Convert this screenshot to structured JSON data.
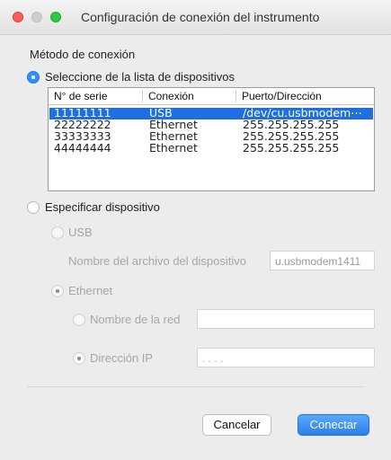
{
  "window": {
    "title": "Configuración de conexión del instrumento",
    "close_color": "#fd5f57",
    "minimize_color": "#cfcfcf",
    "zoom_color": "#2ac940"
  },
  "connection_method": {
    "label": "Método de conexión",
    "list_option": "Seleccione de la lista de dispositivos",
    "list_option_selected": true
  },
  "device_list": {
    "columns": [
      "N° de serie",
      "Conexión",
      "Puerto/Dirección"
    ],
    "rows": [
      {
        "serial": "11111111",
        "connection": "USB",
        "address": "/dev/cu.usbmodem⋯",
        "selected": true
      },
      {
        "serial": "22222222",
        "connection": "Ethernet",
        "address": "255.255.255.255",
        "selected": false
      },
      {
        "serial": "33333333",
        "connection": "Ethernet",
        "address": "255.255.255.255",
        "selected": false
      },
      {
        "serial": "44444444",
        "connection": "Ethernet",
        "address": "255.255.255.255",
        "selected": false
      }
    ]
  },
  "specify": {
    "label": "Especificar dispositivo",
    "usb_label": "USB",
    "device_file_label": "Nombre del archivo del dispositivo",
    "device_file_value": "u.usbmodem1411",
    "ethernet_label": "Ethernet",
    "network_name_label": "Nombre de la red",
    "network_name_value": "",
    "ip_label": "Dirección IP",
    "ip_value": ".   .   .   ."
  },
  "buttons": {
    "cancel": "Cancelar",
    "connect": "Conectar"
  },
  "accent_color": "#2f8ff5"
}
